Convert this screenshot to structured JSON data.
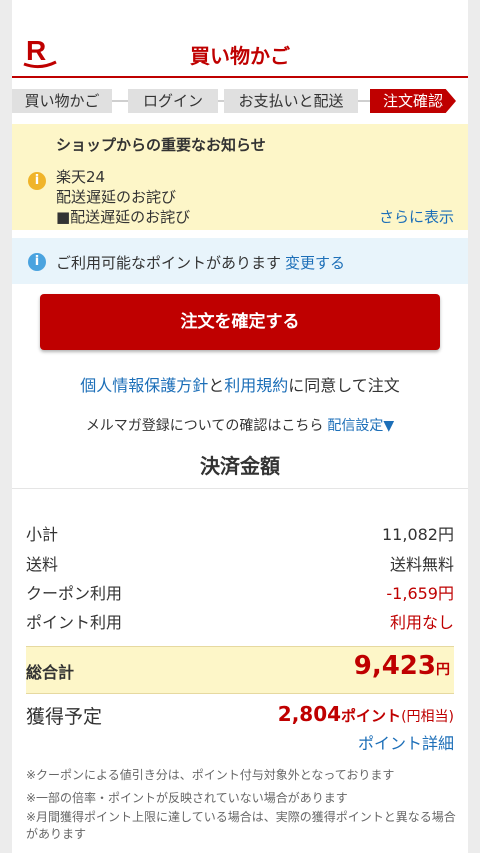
{
  "header": {
    "title": "買い物かご",
    "logo": "R"
  },
  "steps": [
    "買い物かご",
    "ログイン",
    "お支払いと配送",
    "注文確認"
  ],
  "notice": {
    "title": "ショップからの重要なお知らせ",
    "shop": "楽天24",
    "line1": "配送遅延のお詫び",
    "line2": "■配送遅延のお詫び",
    "more": "さらに表示"
  },
  "info": {
    "text": "ご利用可能なポイントがあります",
    "link": "変更する"
  },
  "confirm_button": "注文を確定する",
  "agree": {
    "privacy": "個人情報保護方針",
    "and": "と",
    "terms": "利用規約",
    "rest": "に同意して注文"
  },
  "mail": {
    "text": "メルマガ登録についての確認はこちら",
    "link": "配信設定▼"
  },
  "payment": {
    "title": "決済金額",
    "rows": [
      {
        "label": "小計",
        "value": "11,082円"
      },
      {
        "label": "送料",
        "value": "送料無料"
      },
      {
        "label": "クーポン利用",
        "value": "-1,659円"
      },
      {
        "label": "ポイント利用",
        "value": "利用なし"
      }
    ],
    "total_label": "総合計",
    "total_value": "9,423",
    "total_unit": "円",
    "earn_label": "獲得予定",
    "earn_value": "2,804",
    "earn_unit": "ポイント",
    "earn_unit2": "(円相当)",
    "point_detail": "ポイント詳細"
  },
  "notes": [
    "※クーポンによる値引き分は、ポイント付与対象外となっております",
    "※一部の倍率・ポイントが反映されていない場合があります",
    "※月間獲得ポイント上限に達している場合は、実際の獲得ポイントと異なる場合があります"
  ],
  "colors": {
    "brand": "#bf0000",
    "link": "#1d6fb8",
    "notice_bg": "#fdf6c8",
    "info_bg": "#e8f4fb"
  }
}
